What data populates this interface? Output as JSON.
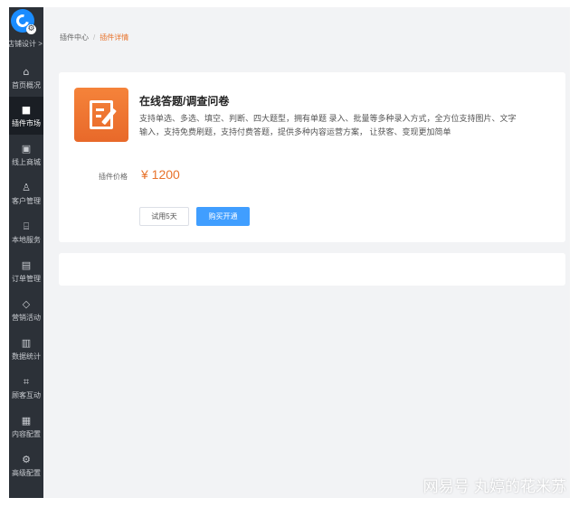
{
  "sidebar": {
    "top_label": "店铺设计 >",
    "items": [
      {
        "label": "首页概况",
        "icon": "home-icon",
        "glyph": "⌂"
      },
      {
        "label": "插件市场",
        "icon": "apps-icon",
        "glyph": "■"
      },
      {
        "label": "线上商城",
        "icon": "shop-icon",
        "glyph": "▣"
      },
      {
        "label": "客户管理",
        "icon": "user-icon",
        "glyph": "♙"
      },
      {
        "label": "本地服务",
        "icon": "store-icon",
        "glyph": "⌸"
      },
      {
        "label": "订单管理",
        "icon": "clipboard-icon",
        "glyph": "▤"
      },
      {
        "label": "营销活动",
        "icon": "diamond-icon",
        "glyph": "◇"
      },
      {
        "label": "数据统计",
        "icon": "chart-icon",
        "glyph": "▥"
      },
      {
        "label": "顾客互动",
        "icon": "scan-icon",
        "glyph": "⌗"
      },
      {
        "label": "内容配置",
        "icon": "document-icon",
        "glyph": "▦"
      },
      {
        "label": "高级配置",
        "icon": "gear-icon",
        "glyph": "⚙"
      }
    ],
    "active_index": 1
  },
  "breadcrumb": {
    "parent": "插件中心",
    "separator": "/",
    "current": "插件详情"
  },
  "plugin": {
    "title": "在线答题/调查问卷",
    "description": "支持单选、多选、填空、判断、四大题型，拥有单题 录入、批量等多种录入方式，全方位支持图片、文字输入，支持免费刷题，支持付费答题，提供多种内容运营方案， 让获客、变现更加简单",
    "price_label": "插件价格",
    "price": "¥ 1200",
    "trial_button": "试用5天",
    "buy_button": "购买开通"
  },
  "watermark": "网易号 丸婷的花米苏",
  "colors": {
    "sidebar_bg": "#2c3138",
    "accent_orange": "#e8732c",
    "primary_blue": "#409eff",
    "logo_blue": "#1a8cff"
  }
}
